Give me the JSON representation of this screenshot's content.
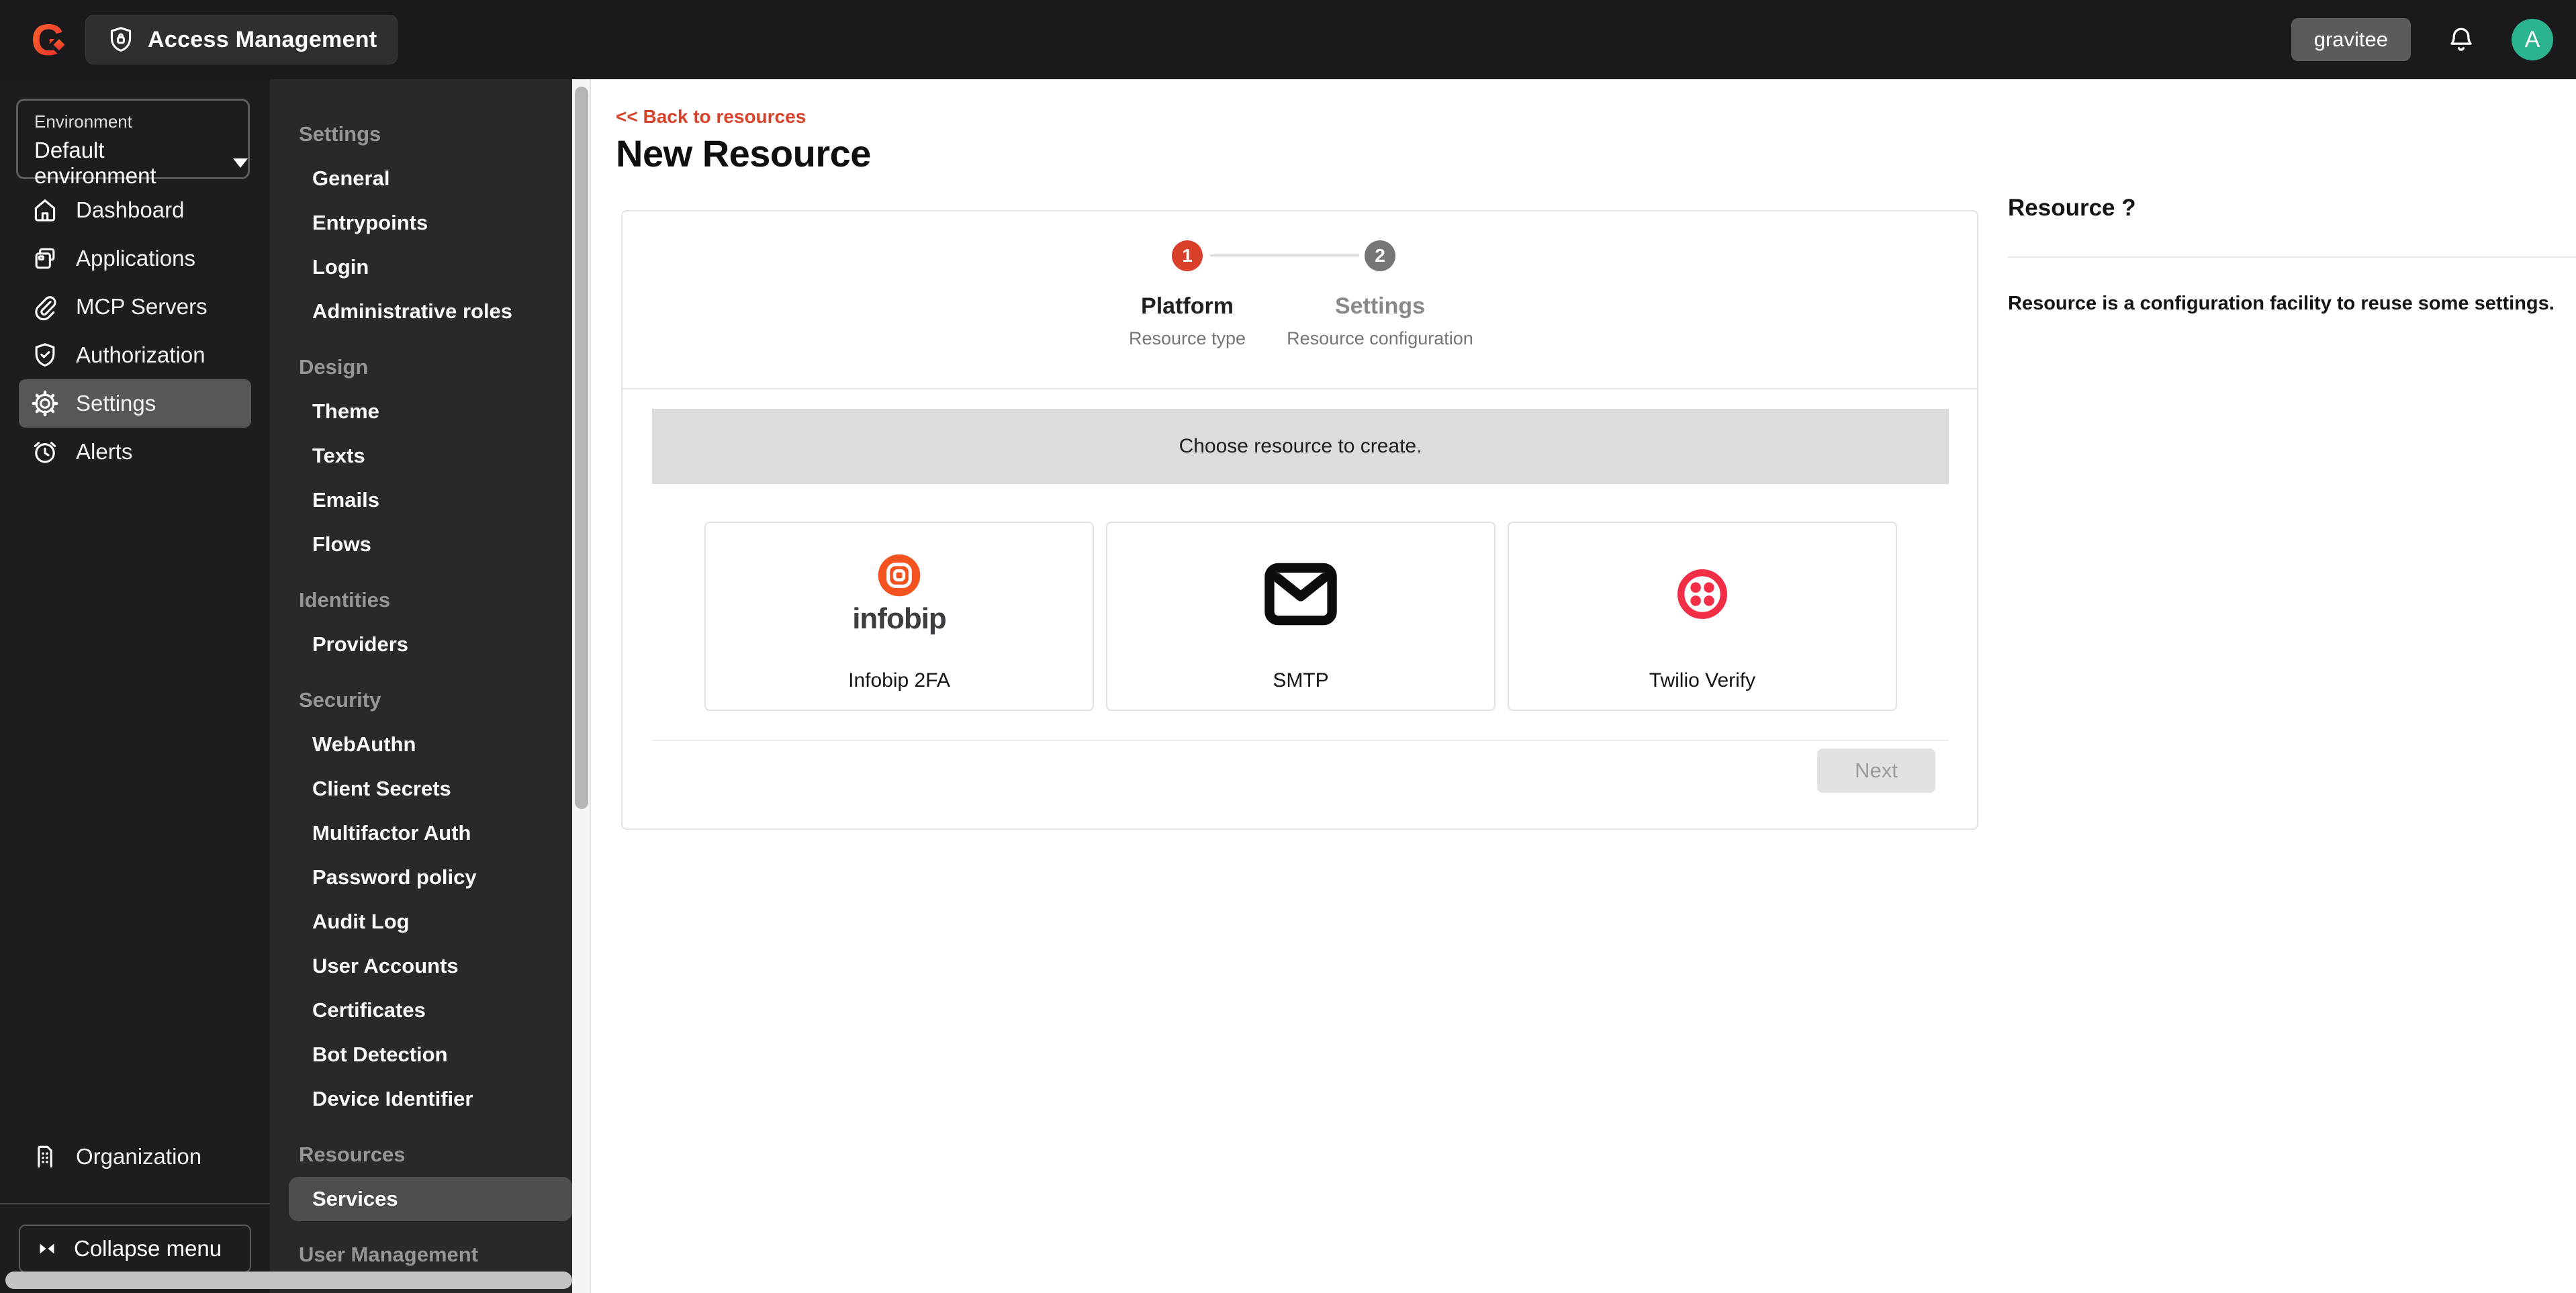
{
  "topbar": {
    "product_badge": "Access Management",
    "org_button": "gravitee",
    "avatar_letter": "A"
  },
  "environment": {
    "label": "Environment",
    "value": "Default environment"
  },
  "primary_nav": {
    "items": [
      {
        "label": "Dashboard",
        "icon": "home-icon",
        "active": false
      },
      {
        "label": "Applications",
        "icon": "applications-icon",
        "active": false
      },
      {
        "label": "MCP Servers",
        "icon": "paperclip-icon",
        "active": false
      },
      {
        "label": "Authorization",
        "icon": "shield-check-icon",
        "active": false
      },
      {
        "label": "Settings",
        "icon": "gear-icon",
        "active": true
      },
      {
        "label": "Alerts",
        "icon": "alarm-clock-icon",
        "active": false
      }
    ],
    "organization_label": "Organization",
    "collapse_label": "Collapse menu"
  },
  "secondary_nav": {
    "sections": [
      {
        "header": "Settings",
        "items": [
          {
            "label": "General"
          },
          {
            "label": "Entrypoints"
          },
          {
            "label": "Login"
          },
          {
            "label": "Administrative roles"
          }
        ]
      },
      {
        "header": "Design",
        "items": [
          {
            "label": "Theme"
          },
          {
            "label": "Texts"
          },
          {
            "label": "Emails"
          },
          {
            "label": "Flows"
          }
        ]
      },
      {
        "header": "Identities",
        "items": [
          {
            "label": "Providers"
          }
        ]
      },
      {
        "header": "Security",
        "items": [
          {
            "label": "WebAuthn"
          },
          {
            "label": "Client Secrets"
          },
          {
            "label": "Multifactor Auth"
          },
          {
            "label": "Password policy"
          },
          {
            "label": "Audit Log"
          },
          {
            "label": "User Accounts"
          },
          {
            "label": "Certificates"
          },
          {
            "label": "Bot Detection"
          },
          {
            "label": "Device Identifier"
          }
        ]
      },
      {
        "header": "Resources",
        "items": [
          {
            "label": "Services",
            "active": true
          }
        ]
      },
      {
        "header": "User Management",
        "items": []
      }
    ]
  },
  "main": {
    "back_link": "<< Back to resources",
    "title": "New Resource",
    "stepper": {
      "steps": [
        {
          "number": "1",
          "label": "Platform",
          "sublabel": "Resource type",
          "active": true
        },
        {
          "number": "2",
          "label": "Settings",
          "sublabel": "Resource configuration",
          "active": false
        }
      ]
    },
    "banner": "Choose resource to create.",
    "resources": [
      {
        "name": "Infobip 2FA",
        "logo": "infobip-logo-icon",
        "logo_text": "infobip"
      },
      {
        "name": "SMTP",
        "logo": "envelope-icon",
        "logo_text": ""
      },
      {
        "name": "Twilio Verify",
        "logo": "twilio-logo-icon",
        "logo_text": ""
      }
    ],
    "next_label": "Next"
  },
  "help_panel": {
    "title": "Resource ?",
    "body": "Resource is a configuration facility to reuse some settings."
  },
  "colors": {
    "accent_red": "#d9432a",
    "step_active": "#d8402a",
    "step_inactive": "#767679",
    "avatar_green": "#2cb390",
    "twilio_red": "#f12e45",
    "infobip_orange": "#f4521e",
    "topbar_bg": "#1a1a1d",
    "primary_sidebar_bg": "#1d1d20",
    "secondary_sidebar_bg": "#29292c",
    "selected_item_bg": "#57575b"
  }
}
